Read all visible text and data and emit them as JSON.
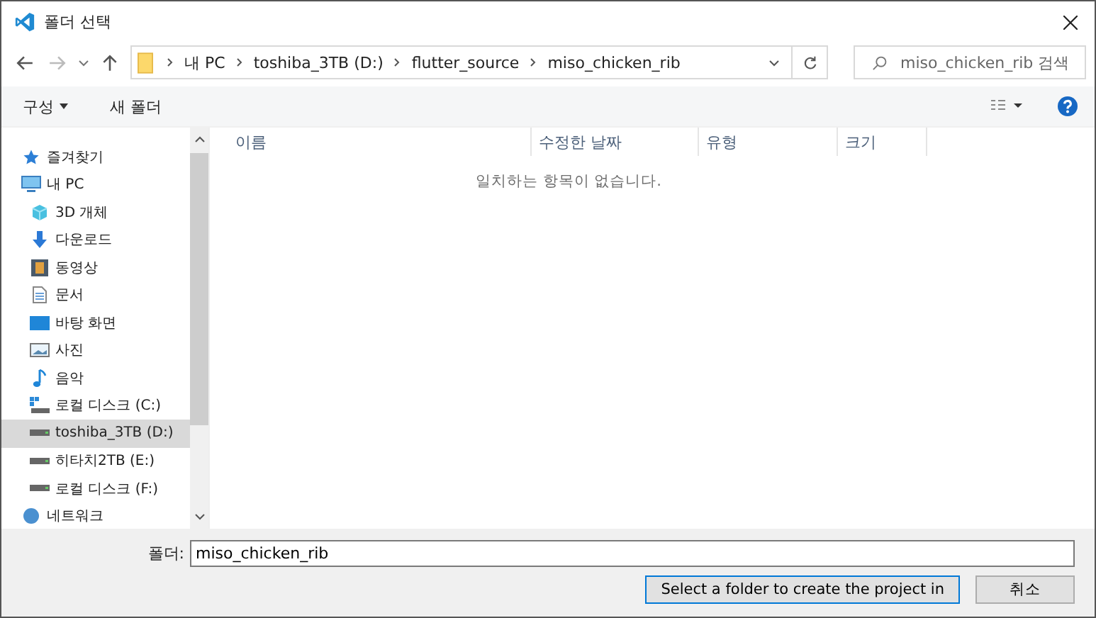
{
  "window": {
    "title": "폴더 선택"
  },
  "breadcrumb": [
    "내 PC",
    "toshiba_3TB (D:)",
    "flutter_source",
    "miso_chicken_rib"
  ],
  "search": {
    "placeholder": "miso_chicken_rib 검색"
  },
  "toolbar": {
    "organize": "구성",
    "new_folder": "새 폴더"
  },
  "sidebar": {
    "items": [
      {
        "label": "즐겨찾기",
        "kind": "star",
        "selected": false
      },
      {
        "label": "내 PC",
        "kind": "pc",
        "selected": false,
        "children": [
          {
            "label": "3D 개체",
            "kind": "cube",
            "selected": false
          },
          {
            "label": "다운로드",
            "kind": "download",
            "selected": false
          },
          {
            "label": "동영상",
            "kind": "video",
            "selected": false
          },
          {
            "label": "문서",
            "kind": "doc",
            "selected": false
          },
          {
            "label": "바탕 화면",
            "kind": "desktop",
            "selected": false
          },
          {
            "label": "사진",
            "kind": "picture",
            "selected": false
          },
          {
            "label": "음악",
            "kind": "music",
            "selected": false
          },
          {
            "label": "로컬 디스크 (C:)",
            "kind": "sysdrive",
            "selected": false
          },
          {
            "label": "toshiba_3TB (D:)",
            "kind": "drive",
            "selected": true
          },
          {
            "label": "히타치2TB (E:)",
            "kind": "drive",
            "selected": false
          },
          {
            "label": "로컬 디스크 (F:)",
            "kind": "drive",
            "selected": false
          }
        ]
      },
      {
        "label": "네트워크",
        "kind": "network",
        "selected": false
      }
    ]
  },
  "table": {
    "columns": [
      "이름",
      "수정한 날짜",
      "유형",
      "크기"
    ],
    "empty_message": "일치하는 항목이 없습니다."
  },
  "folder_field": {
    "label": "폴더:",
    "value": "miso_chicken_rib"
  },
  "buttons": [
    "Select a folder to create the project in",
    "취소"
  ]
}
